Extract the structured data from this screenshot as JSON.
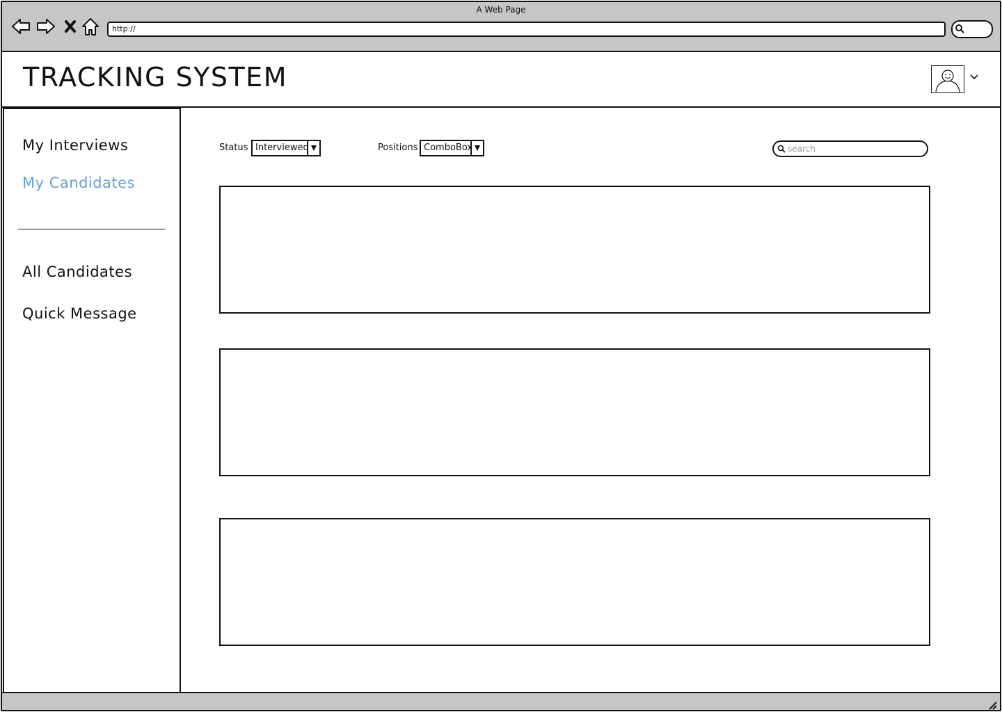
{
  "browser": {
    "window_title": "A Web Page",
    "url": "http://"
  },
  "app": {
    "title": "TRACKING SYSTEM"
  },
  "sidebar": {
    "items": [
      {
        "label": "My Interviews",
        "active": false
      },
      {
        "label": "My Candidates",
        "active": true
      },
      {
        "label": "All Candidates",
        "active": false
      },
      {
        "label": "Quick Message",
        "active": false
      }
    ]
  },
  "filters": {
    "status_label": "Status",
    "status_value": "Interviewed",
    "positions_label": "Positions",
    "positions_value": "ComboBox"
  },
  "search": {
    "placeholder": "search"
  },
  "colors": {
    "chrome_gray": "#c6c6c6",
    "active_link": "#6a9fd4",
    "outline": "#111111"
  },
  "icons": {
    "back": "arrow-left-icon",
    "forward": "arrow-right-icon",
    "stop": "close-icon",
    "home": "home-icon",
    "search": "search-icon",
    "avatar": "user-avatar-icon",
    "dropdown": "chevron-down-icon"
  }
}
